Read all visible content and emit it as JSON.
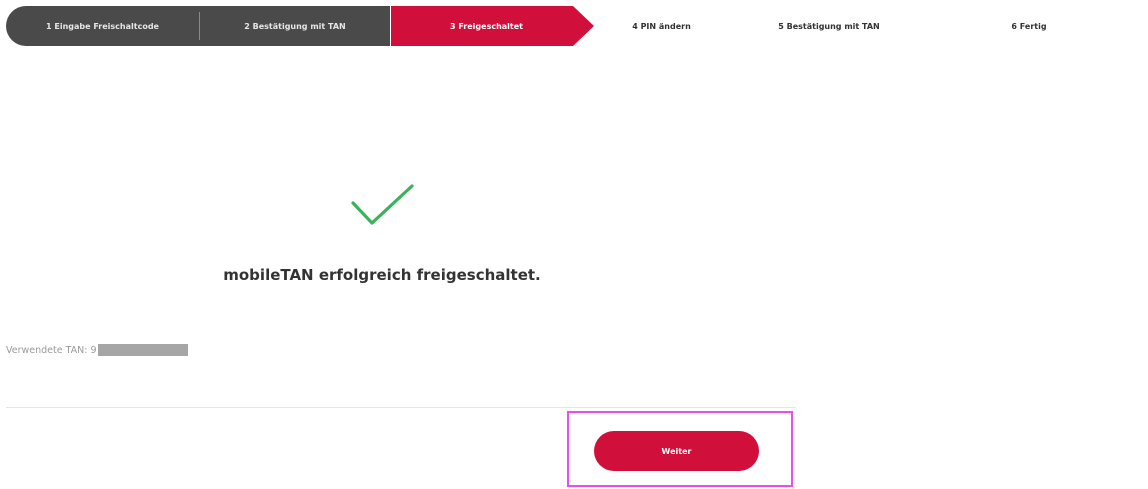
{
  "stepper": {
    "steps": [
      {
        "label": "1  Eingabe Freischaltcode",
        "state": "done"
      },
      {
        "label": "2  Bestätigung mit TAN",
        "state": "done"
      },
      {
        "label": "3  Freigeschaltet",
        "state": "active"
      },
      {
        "label": "4  PIN ändern",
        "state": "pending"
      },
      {
        "label": "5  Bestätigung mit TAN",
        "state": "pending"
      },
      {
        "label": "6  Fertig",
        "state": "pending"
      }
    ]
  },
  "result": {
    "icon": "checkmark-icon",
    "message": "mobileTAN erfolgreich freigeschaltet.",
    "tan_label": "Verwendete TAN: 9"
  },
  "actions": {
    "continue_label": "Weiter"
  },
  "colors": {
    "brand_red": "#d0103a",
    "done_gray": "#4a4a4a",
    "success_green": "#3cb35a",
    "highlight": "#e84ef0"
  }
}
